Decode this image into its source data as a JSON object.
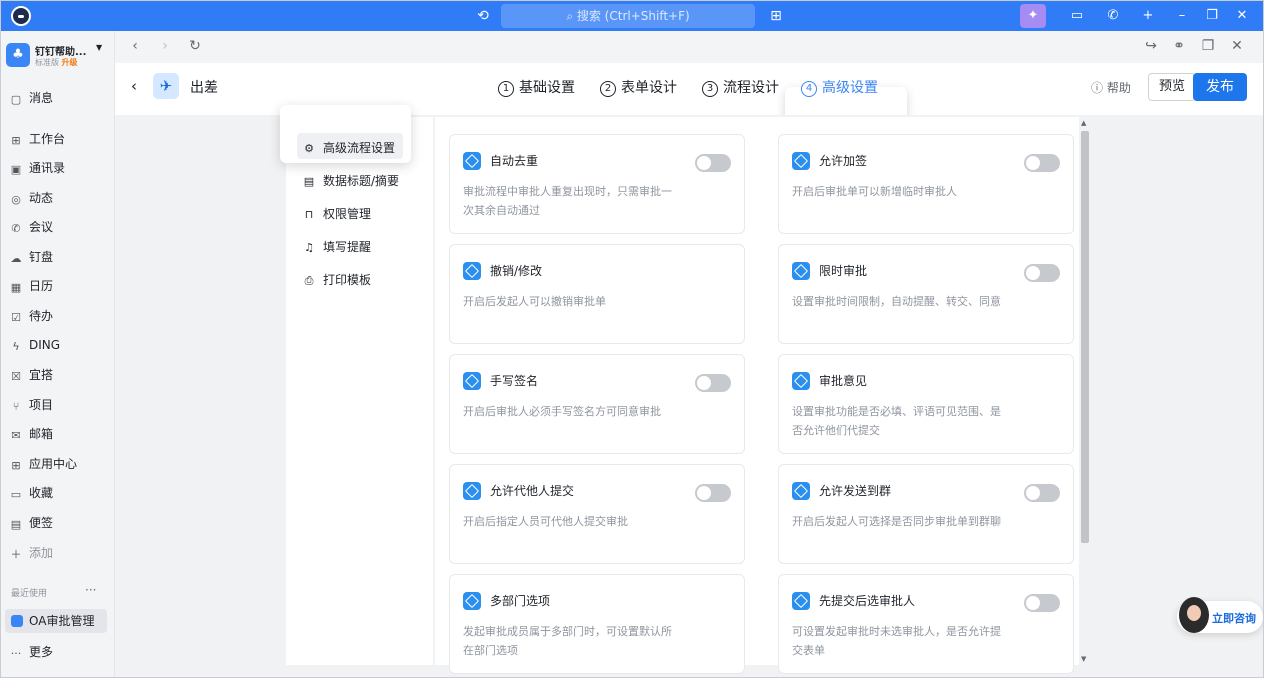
{
  "titlebar": {
    "search_placeholder": "搜索 (Ctrl+Shift+F)"
  },
  "org": {
    "name": "钉钉帮助...",
    "edition": "标准版",
    "upgrade": "升级"
  },
  "sidebar": {
    "items": [
      {
        "label": "消息",
        "icon": "message-icon"
      },
      {
        "label": "工作台",
        "icon": "grid-icon"
      },
      {
        "label": "通讯录",
        "icon": "contacts-icon"
      },
      {
        "label": "动态",
        "icon": "activity-icon"
      },
      {
        "label": "会议",
        "icon": "phone-icon"
      },
      {
        "label": "钉盘",
        "icon": "cloud-icon"
      },
      {
        "label": "日历",
        "icon": "calendar-icon"
      },
      {
        "label": "待办",
        "icon": "todo-icon"
      },
      {
        "label": "DING",
        "icon": "ding-icon"
      },
      {
        "label": "宜搭",
        "icon": "yida-icon"
      },
      {
        "label": "项目",
        "icon": "project-icon"
      },
      {
        "label": "邮箱",
        "icon": "mail-icon"
      },
      {
        "label": "应用中心",
        "icon": "apps-icon"
      },
      {
        "label": "收藏",
        "icon": "favorite-icon"
      },
      {
        "label": "便签",
        "icon": "note-icon"
      },
      {
        "label": "添加",
        "icon": "plus-icon"
      }
    ],
    "recent_label": "最近使用",
    "recent_more": "···",
    "recent_app": "OA审批管理",
    "more_label": "更多"
  },
  "header": {
    "title": "出差",
    "steps": [
      {
        "num": "1",
        "label": "基础设置"
      },
      {
        "num": "2",
        "label": "表单设计"
      },
      {
        "num": "3",
        "label": "流程设计"
      },
      {
        "num": "4",
        "label": "高级设置"
      }
    ],
    "active_step": 4,
    "help": "帮助",
    "preview": "预览",
    "publish": "发布"
  },
  "leftnav": [
    {
      "label": "高级流程设置",
      "icon": "gear-icon"
    },
    {
      "label": "数据标题/摘要",
      "icon": "doc-icon"
    },
    {
      "label": "权限管理",
      "icon": "lock-icon"
    },
    {
      "label": "填写提醒",
      "icon": "bell-icon"
    },
    {
      "label": "打印模板",
      "icon": "printer-icon"
    }
  ],
  "settings": [
    {
      "title": "自动去重",
      "desc": "审批流程中审批人重复出现时，只需审批一次其余自动通过",
      "toggle": true,
      "enabled": false
    },
    {
      "title": "允许加签",
      "desc": "开启后审批单可以新增临时审批人",
      "toggle": true,
      "enabled": false
    },
    {
      "title": "撤销/修改",
      "desc": "开启后发起人可以撤销审批单",
      "toggle": false,
      "enabled": false
    },
    {
      "title": "限时审批",
      "desc": "设置审批时间限制，自动提醒、转交、同意",
      "toggle": true,
      "enabled": false
    },
    {
      "title": "手写签名",
      "desc": "开启后审批人必须手写签名方可同意审批",
      "toggle": true,
      "enabled": false
    },
    {
      "title": "审批意见",
      "desc": "设置审批功能是否必填、评语可见范围、是否允许他们代提交",
      "toggle": false,
      "enabled": false
    },
    {
      "title": "允许代他人提交",
      "desc": "开启后指定人员可代他人提交审批",
      "toggle": true,
      "enabled": false
    },
    {
      "title": "允许发送到群",
      "desc": "开启后发起人可选择是否同步审批单到群聊",
      "toggle": true,
      "enabled": false
    },
    {
      "title": "多部门选项",
      "desc": "发起审批成员属于多部门时，可设置默认所在部门选项",
      "toggle": false,
      "enabled": false
    },
    {
      "title": "先提交后选审批人",
      "desc": "可设置发起审批时未选审批人，是否允许提交表单",
      "toggle": true,
      "enabled": false
    }
  ],
  "consult": "立即咨询",
  "colors": {
    "accent": "#1d76ec",
    "titlebar": "#2f7cf6",
    "upgrade": "#f07c12"
  }
}
